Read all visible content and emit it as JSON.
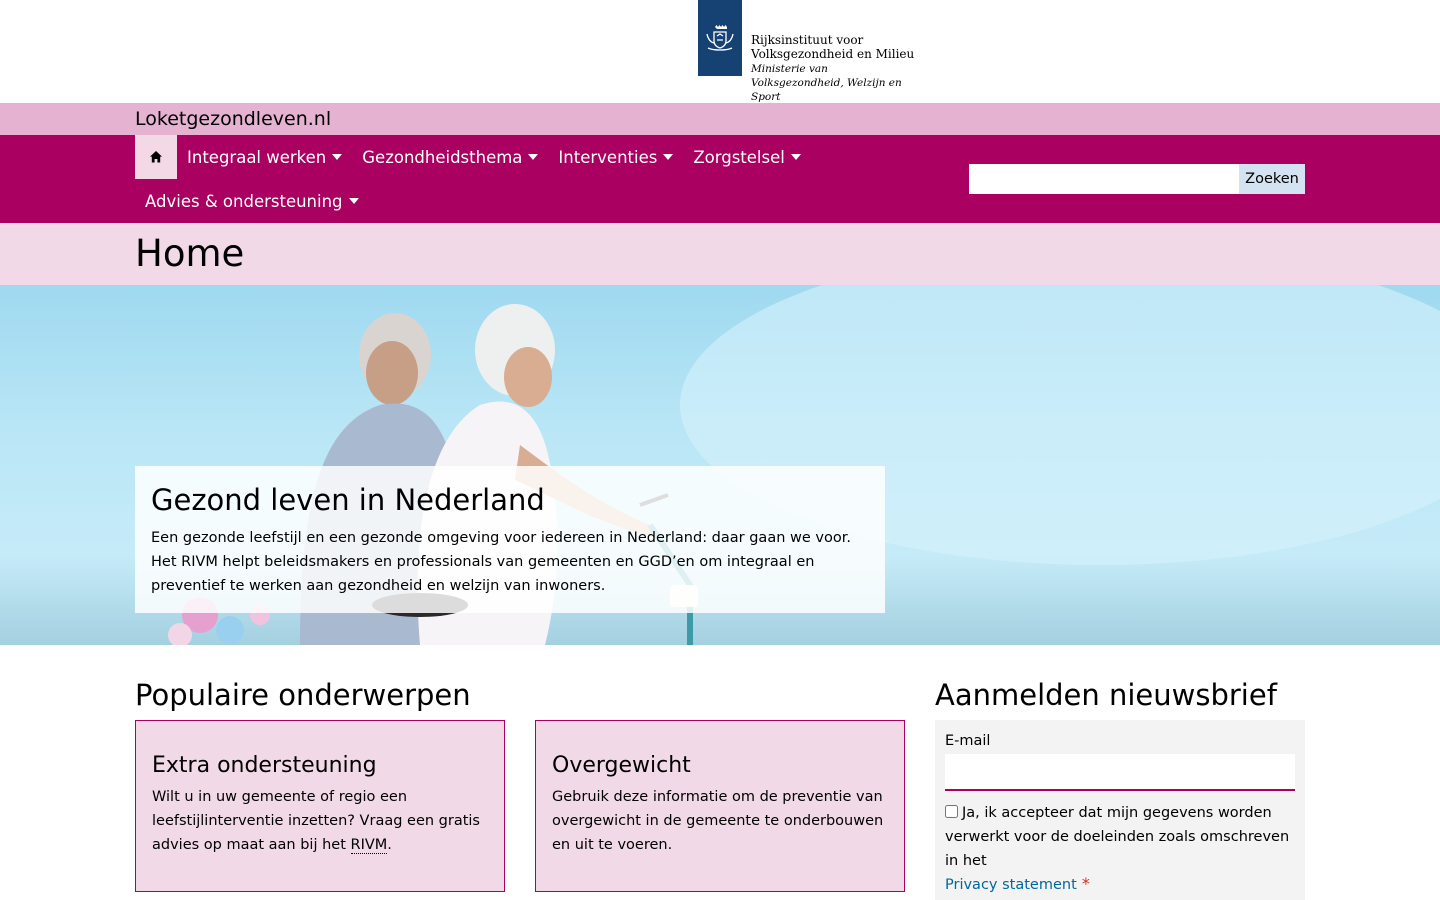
{
  "header": {
    "org_name": "Rijksinstituut voor Volksgezondheid en Milieu",
    "ministry": "Ministerie van Volksgezondheid, Welzijn en Sport",
    "site_name": "Loketgezondleven.nl"
  },
  "nav": {
    "home_icon": "home-icon",
    "items": [
      {
        "label": "Integraal werken"
      },
      {
        "label": "Gezondheidsthema"
      },
      {
        "label": "Interventies"
      },
      {
        "label": "Zorgstelsel"
      },
      {
        "label": "Advies & ondersteuning"
      }
    ],
    "search": {
      "placeholder": "",
      "button_label": "Zoeken"
    }
  },
  "page": {
    "title": "Home"
  },
  "hero": {
    "title": "Gezond leven in Nederland",
    "text": "Een gezonde leefstijl en een gezonde omgeving voor iedereen in Nederland: daar gaan we voor. Het RIVM helpt beleidsmakers en professionals van gemeenten en GGD’en om integraal en preventief te werken aan gezondheid en welzijn van inwoners."
  },
  "popular": {
    "title": "Populaire onderwerpen",
    "cards": [
      {
        "title": "Extra ondersteuning",
        "text_before": "Wilt u in uw gemeente of regio een leefstijlinterventie inzetten? Vraag een gratis advies op maat aan bij het ",
        "abbr": "RIVM",
        "text_after": "."
      },
      {
        "title": "Overgewicht",
        "text": "Gebruik deze informatie om de preventie van overgewicht in de gemeente te onderbouwen en uit te voeren."
      }
    ]
  },
  "newsletter": {
    "title": "Aanmelden nieuwsbrief",
    "email_label": "E-mail",
    "email_value": "",
    "consent_text": "Ja, ik accepteer dat mijn gegevens worden verwerkt voor de doeleinden zoals omschreven in het",
    "privacy_link": "Privacy statement",
    "required_mark": "*"
  },
  "colors": {
    "brand": "#a90061",
    "brand_light": "#e5b2d1",
    "brand_lighter": "#f2d9e7",
    "rijks_blue": "#154273",
    "link": "#01689b"
  }
}
